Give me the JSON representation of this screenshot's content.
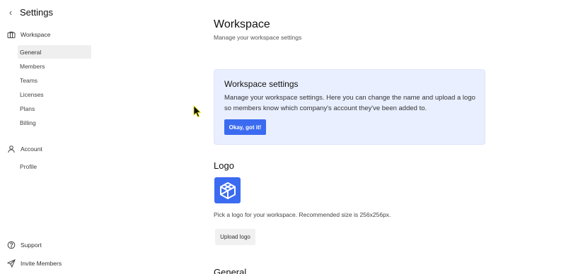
{
  "sidebar": {
    "title": "Settings",
    "sections": [
      {
        "label": "Workspace",
        "icon": "briefcase-icon"
      },
      {
        "label": "Account",
        "icon": "user-icon"
      }
    ],
    "workspace_items": [
      {
        "label": "General",
        "active": true
      },
      {
        "label": "Members"
      },
      {
        "label": "Teams"
      },
      {
        "label": "Licenses"
      },
      {
        "label": "Plans"
      },
      {
        "label": "Billing"
      }
    ],
    "account_items": [
      {
        "label": "Profile"
      }
    ],
    "footer_items": [
      {
        "label": "Support",
        "icon": "help-circle-icon"
      },
      {
        "label": "Invite Members",
        "icon": "send-icon"
      }
    ]
  },
  "main": {
    "title": "Workspace",
    "subtitle": "Manage your workspace settings",
    "info_card": {
      "title": "Workspace settings",
      "text": "Manage your workspace settings. Here you can change the name and upload a logo so members know which company's account they've been added to.",
      "button": "Okay, got it!"
    },
    "logo": {
      "heading": "Logo",
      "hint": "Pick a logo for your workspace. Recommended size is 256x256px.",
      "upload_button": "Upload logo",
      "icon": "cube-logo-icon"
    },
    "general_heading": "General"
  },
  "colors": {
    "accent": "#3b6bf0",
    "info_bg": "#e9efff",
    "active_item_bg": "#efefef"
  }
}
